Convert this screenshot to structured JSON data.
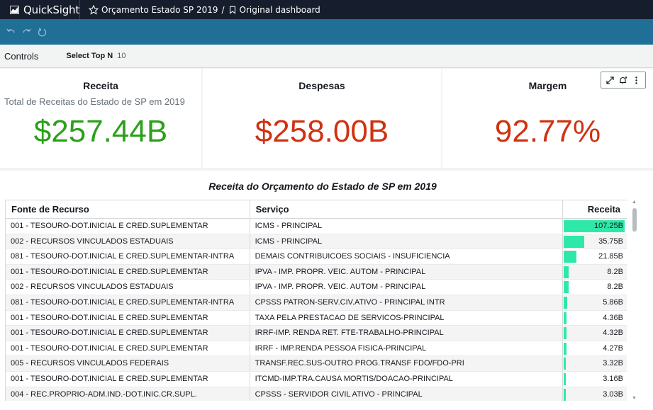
{
  "app": {
    "name": "QuickSight"
  },
  "breadcrumb": {
    "analysis": "Orçamento Estado SP 2019",
    "separator": "/",
    "dashboard": "Original dashboard"
  },
  "toolbar": {
    "undo": "undo-icon",
    "redo": "redo-icon",
    "reset": "reset-icon"
  },
  "controls": {
    "label": "Controls",
    "topn_label": "Select Top N",
    "topn_value": "10"
  },
  "kpis": [
    {
      "title": "Receita",
      "subtitle": "Total de Receitas do Estado de SP em 2019",
      "value": "$257.44B",
      "color": "#2ca01c"
    },
    {
      "title": "Despesas",
      "subtitle": "",
      "value": "$258.00B",
      "color": "#d13212"
    },
    {
      "title": "Margem",
      "subtitle": "",
      "value": "92.77%",
      "color": "#d13212"
    }
  ],
  "table": {
    "title": "Receita do Orçamento do Estado de SP em 2019",
    "columns": [
      "Fonte de Recurso",
      "Serviço",
      "Receita"
    ],
    "max_value": 107.25,
    "bar_color": "#2ee8a8",
    "rows": [
      {
        "fonte": "001 - TESOURO-DOT.INICIAL E CRED.SUPLEMENTAR",
        "servico": "ICMS - PRINCIPAL",
        "receita": "107.25B",
        "value": 107.25
      },
      {
        "fonte": "002 - RECURSOS VINCULADOS ESTADUAIS",
        "servico": "ICMS - PRINCIPAL",
        "receita": "35.75B",
        "value": 35.75
      },
      {
        "fonte": "081 - TESOURO-DOT.INICIAL E CRED.SUPLEMENTAR-INTRA",
        "servico": "DEMAIS CONTRIBUICOES SOCIAIS - INSUFICIENCIA",
        "receita": "21.85B",
        "value": 21.85
      },
      {
        "fonte": "001 - TESOURO-DOT.INICIAL E CRED.SUPLEMENTAR",
        "servico": "IPVA - IMP. PROPR. VEIC. AUTOM  - PRINCIPAL",
        "receita": "8.2B",
        "value": 8.2
      },
      {
        "fonte": "002 - RECURSOS VINCULADOS ESTADUAIS",
        "servico": "IPVA - IMP. PROPR. VEIC. AUTOM  - PRINCIPAL",
        "receita": "8.2B",
        "value": 8.2
      },
      {
        "fonte": "081 - TESOURO-DOT.INICIAL E CRED.SUPLEMENTAR-INTRA",
        "servico": "CPSSS PATRON-SERV.CIV.ATIVO - PRINCIPAL INTR",
        "receita": "5.86B",
        "value": 5.86
      },
      {
        "fonte": "001 - TESOURO-DOT.INICIAL E CRED.SUPLEMENTAR",
        "servico": "TAXA PELA  PRESTACAO DE SERVICOS-PRINCIPAL",
        "receita": "4.36B",
        "value": 4.36
      },
      {
        "fonte": "001 - TESOURO-DOT.INICIAL E CRED.SUPLEMENTAR",
        "servico": "IRRF-IMP. RENDA RET. FTE-TRABALHO-PRINCIPAL",
        "receita": "4.32B",
        "value": 4.32
      },
      {
        "fonte": "001 - TESOURO-DOT.INICIAL E CRED.SUPLEMENTAR",
        "servico": "IRRF - IMP.RENDA PESSOA FISICA-PRINCIPAL",
        "receita": "4.27B",
        "value": 4.27
      },
      {
        "fonte": "005 - RECURSOS VINCULADOS FEDERAIS",
        "servico": "TRANSF.REC.SUS-OUTRO PROG.TRANSF FDO/FDO-PRI",
        "receita": "3.32B",
        "value": 3.32
      },
      {
        "fonte": "001 - TESOURO-DOT.INICIAL E CRED.SUPLEMENTAR",
        "servico": "ITCMD-IMP.TRA.CAUSA MORTIS/DOACAO-PRINCIPAL",
        "receita": "3.16B",
        "value": 3.16
      },
      {
        "fonte": "004 - REC.PROPRIO-ADM.IND.-DOT.INIC.CR.SUPL.",
        "servico": "CPSSS - SERVIDOR CIVIL  ATIVO - PRINCIPAL",
        "receita": "3.03B",
        "value": 3.03
      }
    ]
  }
}
